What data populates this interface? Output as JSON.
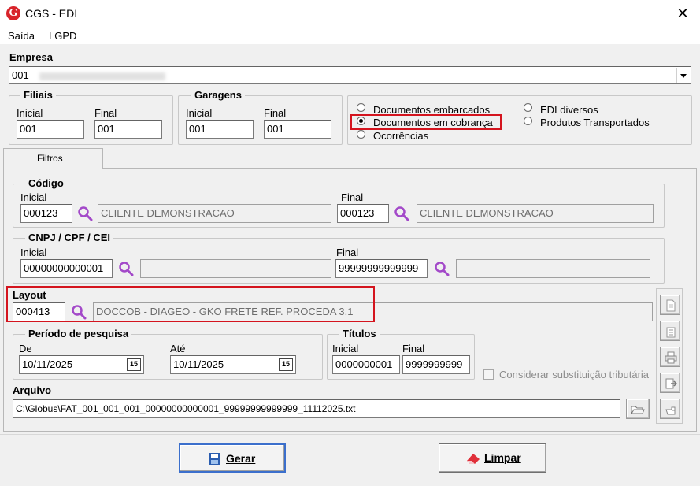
{
  "window": {
    "title": "CGS - EDI",
    "logo_letter": "G"
  },
  "menu": [
    {
      "label": "Saída"
    },
    {
      "label": "LGPD"
    }
  ],
  "empresa": {
    "label": "Empresa",
    "value": "001"
  },
  "filiais": {
    "legend": "Filiais",
    "inicial_label": "Inicial",
    "inicial_value": "001",
    "final_label": "Final",
    "final_value": "001"
  },
  "garagens": {
    "legend": "Garagens",
    "inicial_label": "Inicial",
    "inicial_value": "001",
    "final_label": "Final",
    "final_value": "001"
  },
  "options": {
    "docs_embarcados": "Documentos embarcados",
    "docs_cobranca": "Documentos em cobrança",
    "ocorrencias": "Ocorrências",
    "edi_diversos": "EDI diversos",
    "produtos_transportados": "Produtos Transportados",
    "selected": "Documentos em cobrança"
  },
  "tabs": [
    {
      "label": "Filtros"
    }
  ],
  "codigo": {
    "legend": "Código",
    "inicial_label": "Inicial",
    "inicial_value": "000123",
    "inicial_desc": "CLIENTE DEMONSTRACAO",
    "final_label": "Final",
    "final_value": "000123",
    "final_desc": "CLIENTE DEMONSTRACAO"
  },
  "cnpj": {
    "legend": "CNPJ / CPF / CEI",
    "inicial_label": "Inicial",
    "inicial_value": "00000000000001",
    "inicial_desc": "",
    "final_label": "Final",
    "final_value": "99999999999999",
    "final_desc": ""
  },
  "layout": {
    "label": "Layout",
    "code": "000413",
    "desc": "DOCCOB - DIAGEO - GKO FRETE REF. PROCEDA 3.1"
  },
  "periodo": {
    "legend": "Período de pesquisa",
    "de_label": "De",
    "de_value": "10/11/2025",
    "ate_label": "Até",
    "ate_value": "10/11/2025",
    "cal_glyph": "15"
  },
  "titulos": {
    "legend": "Títulos",
    "inicial_label": "Inicial",
    "inicial_value": "0000000001",
    "final_label": "Final",
    "final_value": "9999999999"
  },
  "substituicao": {
    "label": "Considerar substituição tributária",
    "checked": false
  },
  "arquivo": {
    "label": "Arquivo",
    "value": "C:\\Globus\\FAT_001_001_001_00000000000001_99999999999999_11112025.txt"
  },
  "buttons": {
    "gerar": "Gerar",
    "limpar": "Limpar"
  },
  "colors": {
    "accent_red": "#d4141e",
    "magnifier": "#a349c9",
    "focus_blue": "#3b6fcc"
  }
}
